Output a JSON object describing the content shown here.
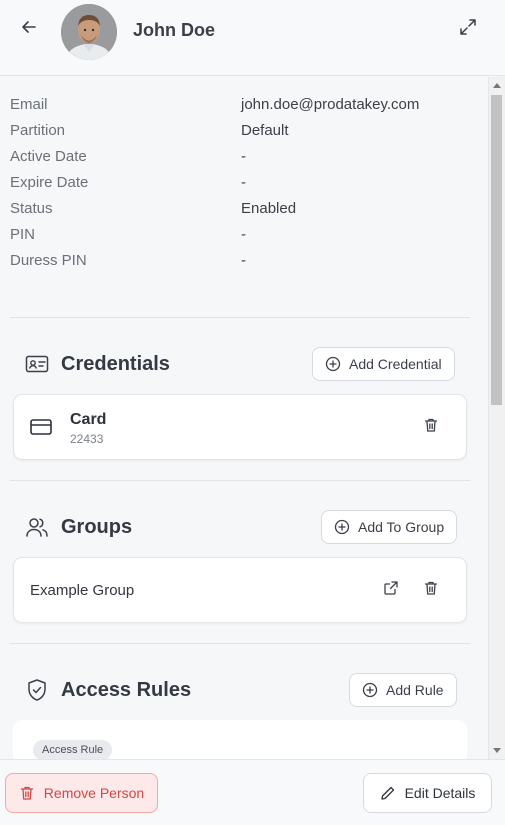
{
  "header": {
    "person_name": "John Doe"
  },
  "details": [
    {
      "label": "Email",
      "value": "john.doe@prodatakey.com"
    },
    {
      "label": "Partition",
      "value": "Default"
    },
    {
      "label": "Active Date",
      "value": "-"
    },
    {
      "label": "Expire Date",
      "value": "-"
    },
    {
      "label": "Status",
      "value": "Enabled"
    },
    {
      "label": "PIN",
      "value": "-"
    },
    {
      "label": "Duress PIN",
      "value": "-"
    }
  ],
  "credentials": {
    "title": "Credentials",
    "add_label": "Add Credential",
    "items": [
      {
        "type": "Card",
        "number": "22433",
        "icon": "card-icon"
      }
    ]
  },
  "groups": {
    "title": "Groups",
    "add_label": "Add To Group",
    "items": [
      {
        "name": "Example Group"
      }
    ]
  },
  "access_rules": {
    "title": "Access Rules",
    "add_label": "Add Rule",
    "items": [
      {
        "tag": "Access Rule"
      }
    ]
  },
  "footer": {
    "remove_label": "Remove Person",
    "edit_label": "Edit Details"
  },
  "colors": {
    "danger": "#d64545",
    "danger_bg": "#fde9e9",
    "text": "#2b2f36",
    "muted": "#6b7078"
  },
  "icons": {
    "back": "arrow-left-icon",
    "expand": "expand-icon",
    "credentials": "id-card-icon",
    "groups": "users-icon",
    "access_rules": "shield-check-icon",
    "add": "plus-circle-icon",
    "delete": "trash-icon",
    "open": "external-link-icon",
    "edit": "pencil-icon"
  }
}
